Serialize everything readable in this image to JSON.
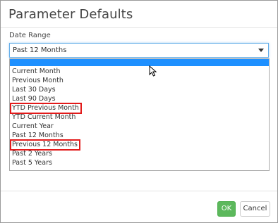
{
  "dialog": {
    "title": "Parameter Defaults",
    "field_label": "Date Range",
    "selected_value": "Past 12 Months",
    "options": [
      "Current Month",
      "Previous Month",
      "Last 30 Days",
      "Last 90 Days",
      "YTD Previous Month",
      "YTD Current Month",
      "Current Year",
      "Past 12 Months",
      "Previous 12 Months",
      "Past 2 Years",
      "Past 5 Years"
    ],
    "highlight_color": "#1e90ff",
    "annotation_color": "#e21a1a"
  },
  "footer": {
    "ok_label": "OK",
    "cancel_label": "Cancel",
    "ok_color": "#5cb85c"
  }
}
